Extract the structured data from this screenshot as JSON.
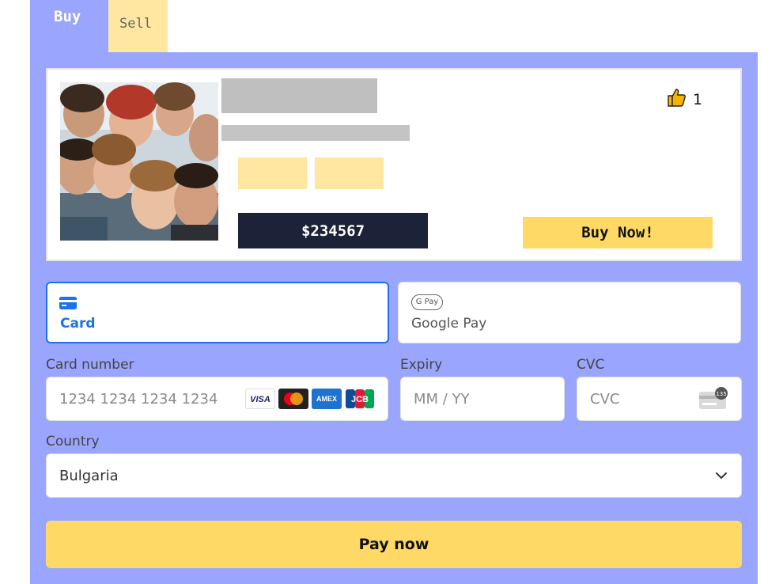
{
  "tabs": {
    "buy": "Buy",
    "sell": "Sell"
  },
  "product": {
    "likes": "1",
    "price": "$234567",
    "buy_button": "Buy Now!"
  },
  "payment_methods": {
    "card": {
      "label": "Card",
      "icon": "credit-card-icon"
    },
    "gpay": {
      "label": "Google Pay",
      "badge": "G Pay"
    }
  },
  "card_number": {
    "label": "Card number",
    "placeholder": "1234 1234 1234 1234",
    "brands": [
      "VISA",
      "Mastercard",
      "American Express",
      "JCB"
    ]
  },
  "expiry": {
    "label": "Expiry",
    "placeholder": "MM / YY"
  },
  "cvc": {
    "label": "CVC",
    "placeholder": "CVC",
    "badge": "135"
  },
  "country": {
    "label": "Country",
    "value": "Bulgaria"
  },
  "pay_button": "Pay now",
  "colors": {
    "panel": "#9aa5fd",
    "accent": "#ffd966",
    "tag": "#ffe7a1",
    "price_bg": "#1c2237",
    "selected_border": "#1a73e8"
  }
}
